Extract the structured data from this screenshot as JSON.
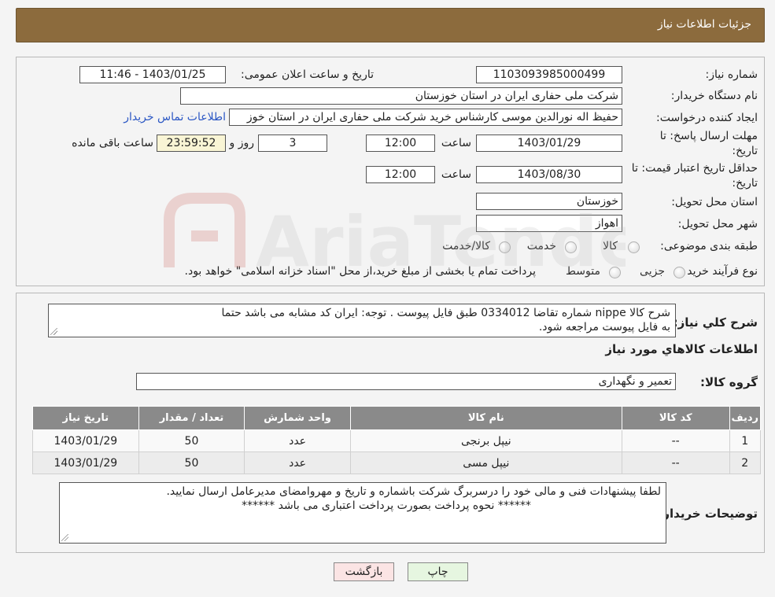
{
  "header": {
    "title": "جزئیات اطلاعات نیاز"
  },
  "labels": {
    "need_number": "شماره نیاز:",
    "public_date": "تاریخ و ساعت اعلان عمومی:",
    "buyer_org": "نام دستگاه خریدار:",
    "creator": "ایجاد کننده درخواست:",
    "deadline_line1": "مهلت ارسال پاسخ: تا",
    "deadline_line2": "تاریخ:",
    "validity_line1": "حداقل تاریخ اعتبار قیمت: تا",
    "validity_line2": "تاریخ:",
    "time_word": "ساعت",
    "day_and": "روز و",
    "remaining": "ساعت باقی مانده",
    "province": "استان محل تحویل:",
    "city": "شهر محل تحویل:",
    "category": "طبقه بندی موضوعی:",
    "process": "نوع فرآیند خرید :",
    "general_desc": "شرح کلي نياز:",
    "items_info": "اطلاعات كالاهاي مورد نياز",
    "goods_group": "گروه کالا:",
    "buyer_notes": "توضیحات خریدار:"
  },
  "fields": {
    "need_number": "1103093985000499",
    "public_date": "1403/01/25 - 11:46",
    "buyer_org": "شرکت ملی حفاری ایران در استان خوزستان",
    "creator": "حفیظ اله نورالدین موسی کارشناس خرید شرکت ملی حفاری ایران در استان خوز",
    "contact_link": "اطلاعات تماس خریدار",
    "deadline_date": "1403/01/29",
    "deadline_time": "12:00",
    "days": "3",
    "remaining_time": "23:59:52",
    "validity_date": "1403/08/30",
    "validity_time": "12:00",
    "province": "خوزستان",
    "city": "اهواز",
    "category_options": [
      "کالا",
      "خدمت",
      "کالا/خدمت"
    ],
    "process_options": [
      "جزیی",
      "متوسط"
    ],
    "process_note": "پرداخت تمام یا بخشی از مبلغ خرید،از محل \"اسناد خزانه اسلامی\" خواهد بود.",
    "general_desc_line1": "شرح کالا     nippe    شماره تقاضا   0334012       طبق فایل پیوست . توجه: ایران کد مشابه می باشد حتما",
    "general_desc_line2": "به فایل پیوست مراجعه شود.",
    "goods_group": "تعمیر و نگهداری",
    "buyer_notes_line1": "لطفا پیشنهادات فنی و مالی خود را درسربرگ شرکت باشماره و تاریخ و مهروامضای مدیرعامل ارسال نمایید.",
    "buyer_notes_line2": "****** نحوه پرداخت بصورت پرداخت اعتباری می باشد ******"
  },
  "table": {
    "headers": [
      "ردیف",
      "کد کالا",
      "نام کالا",
      "واحد شمارش",
      "تعداد / مقدار",
      "تاریخ نیاز"
    ],
    "rows": [
      [
        "1",
        "--",
        "نیپل برنجی",
        "عدد",
        "50",
        "1403/01/29"
      ],
      [
        "2",
        "--",
        "نیپل مسی",
        "عدد",
        "50",
        "1403/01/29"
      ]
    ]
  },
  "buttons": {
    "print": "چاپ",
    "back": "بازگشت"
  },
  "watermark": {
    "text": "AriaTender.neT"
  },
  "colors": {
    "header_bg": "#8c6b3d",
    "table_header_bg": "#8a8a8a",
    "link": "#2b57c4"
  }
}
